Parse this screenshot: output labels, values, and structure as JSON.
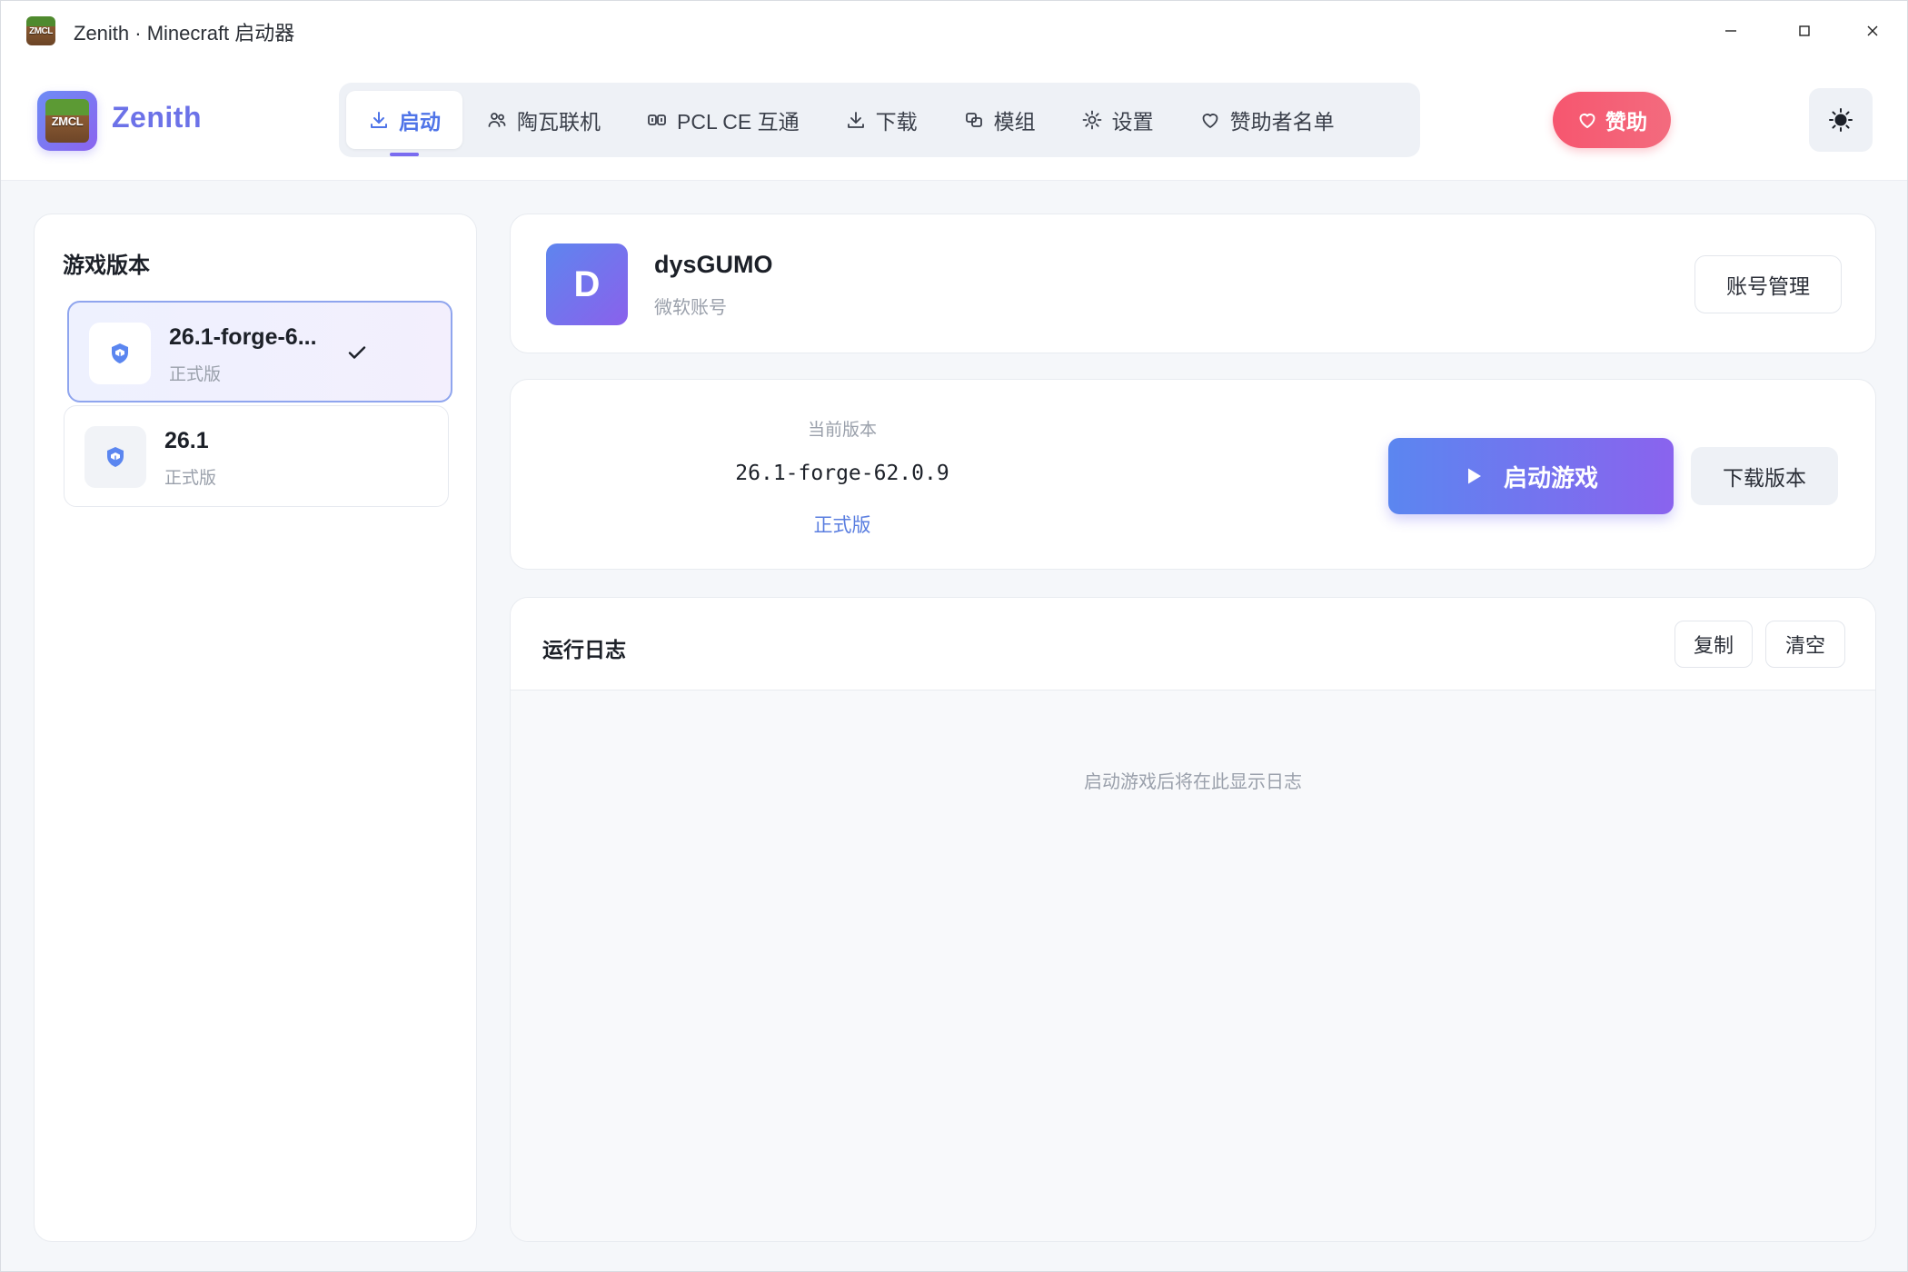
{
  "window": {
    "app_icon_text": "ZMCL",
    "title": "Zenith · Minecraft 启动器"
  },
  "header": {
    "logo_text": "ZMCL",
    "brand": "Zenith",
    "nav": [
      {
        "label": "启动",
        "icon": "download-icon",
        "active": true
      },
      {
        "label": "陶瓦联机",
        "icon": "users-icon",
        "active": false
      },
      {
        "label": "PCL CE 互通",
        "icon": "link-icon",
        "active": false
      },
      {
        "label": "下载",
        "icon": "download-icon",
        "active": false
      },
      {
        "label": "模组",
        "icon": "mods-icon",
        "active": false
      },
      {
        "label": "设置",
        "icon": "gear-icon",
        "active": false
      },
      {
        "label": "赞助者名单",
        "icon": "heart-icon",
        "active": false
      }
    ],
    "sponsor_label": "赞助",
    "theme_icon": "sun-icon"
  },
  "sidebar": {
    "title": "游戏版本",
    "versions": [
      {
        "name": "26.1-forge-6...",
        "type": "正式版",
        "selected": true
      },
      {
        "name": "26.1",
        "type": "正式版",
        "selected": false
      }
    ]
  },
  "account": {
    "avatar_letter": "D",
    "name": "dysGUMO",
    "type": "微软账号",
    "manage_label": "账号管理"
  },
  "launch": {
    "current_label": "当前版本",
    "current_version": "26.1-forge-62.0.9",
    "current_type": "正式版",
    "launch_label": "启动游戏",
    "download_label": "下载版本"
  },
  "log": {
    "title": "运行日志",
    "copy_label": "复制",
    "clear_label": "清空",
    "empty_text": "启动游戏后将在此显示日志"
  },
  "colors": {
    "accent": "#4f74e8",
    "accent_gradient_start": "#5b86f0",
    "accent_gradient_end": "#8a63ee",
    "sponsor": "#f6566f"
  }
}
